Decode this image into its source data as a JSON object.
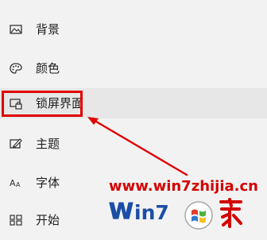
{
  "nav": {
    "items": [
      {
        "label": "背景",
        "icon": "image-icon",
        "selected": false
      },
      {
        "label": "颜色",
        "icon": "palette-icon",
        "selected": false
      },
      {
        "label": "锁屏界面",
        "icon": "lock-screen-icon",
        "selected": true
      },
      {
        "label": "主题",
        "icon": "theme-brush-icon",
        "selected": false
      },
      {
        "label": "字体",
        "icon": "font-icon",
        "selected": false
      },
      {
        "label": "开始",
        "icon": "start-grid-icon",
        "selected": false
      }
    ]
  },
  "watermark": {
    "url": "www.win7zhijia.cn",
    "logo_text": "Win7系统之家"
  },
  "colors": {
    "background": "#f2f2f2",
    "selected_background": "#e7e7e7",
    "highlight": "#e00000",
    "watermark_red": "#d30000",
    "watermark_blue": "#1c4ea7"
  }
}
